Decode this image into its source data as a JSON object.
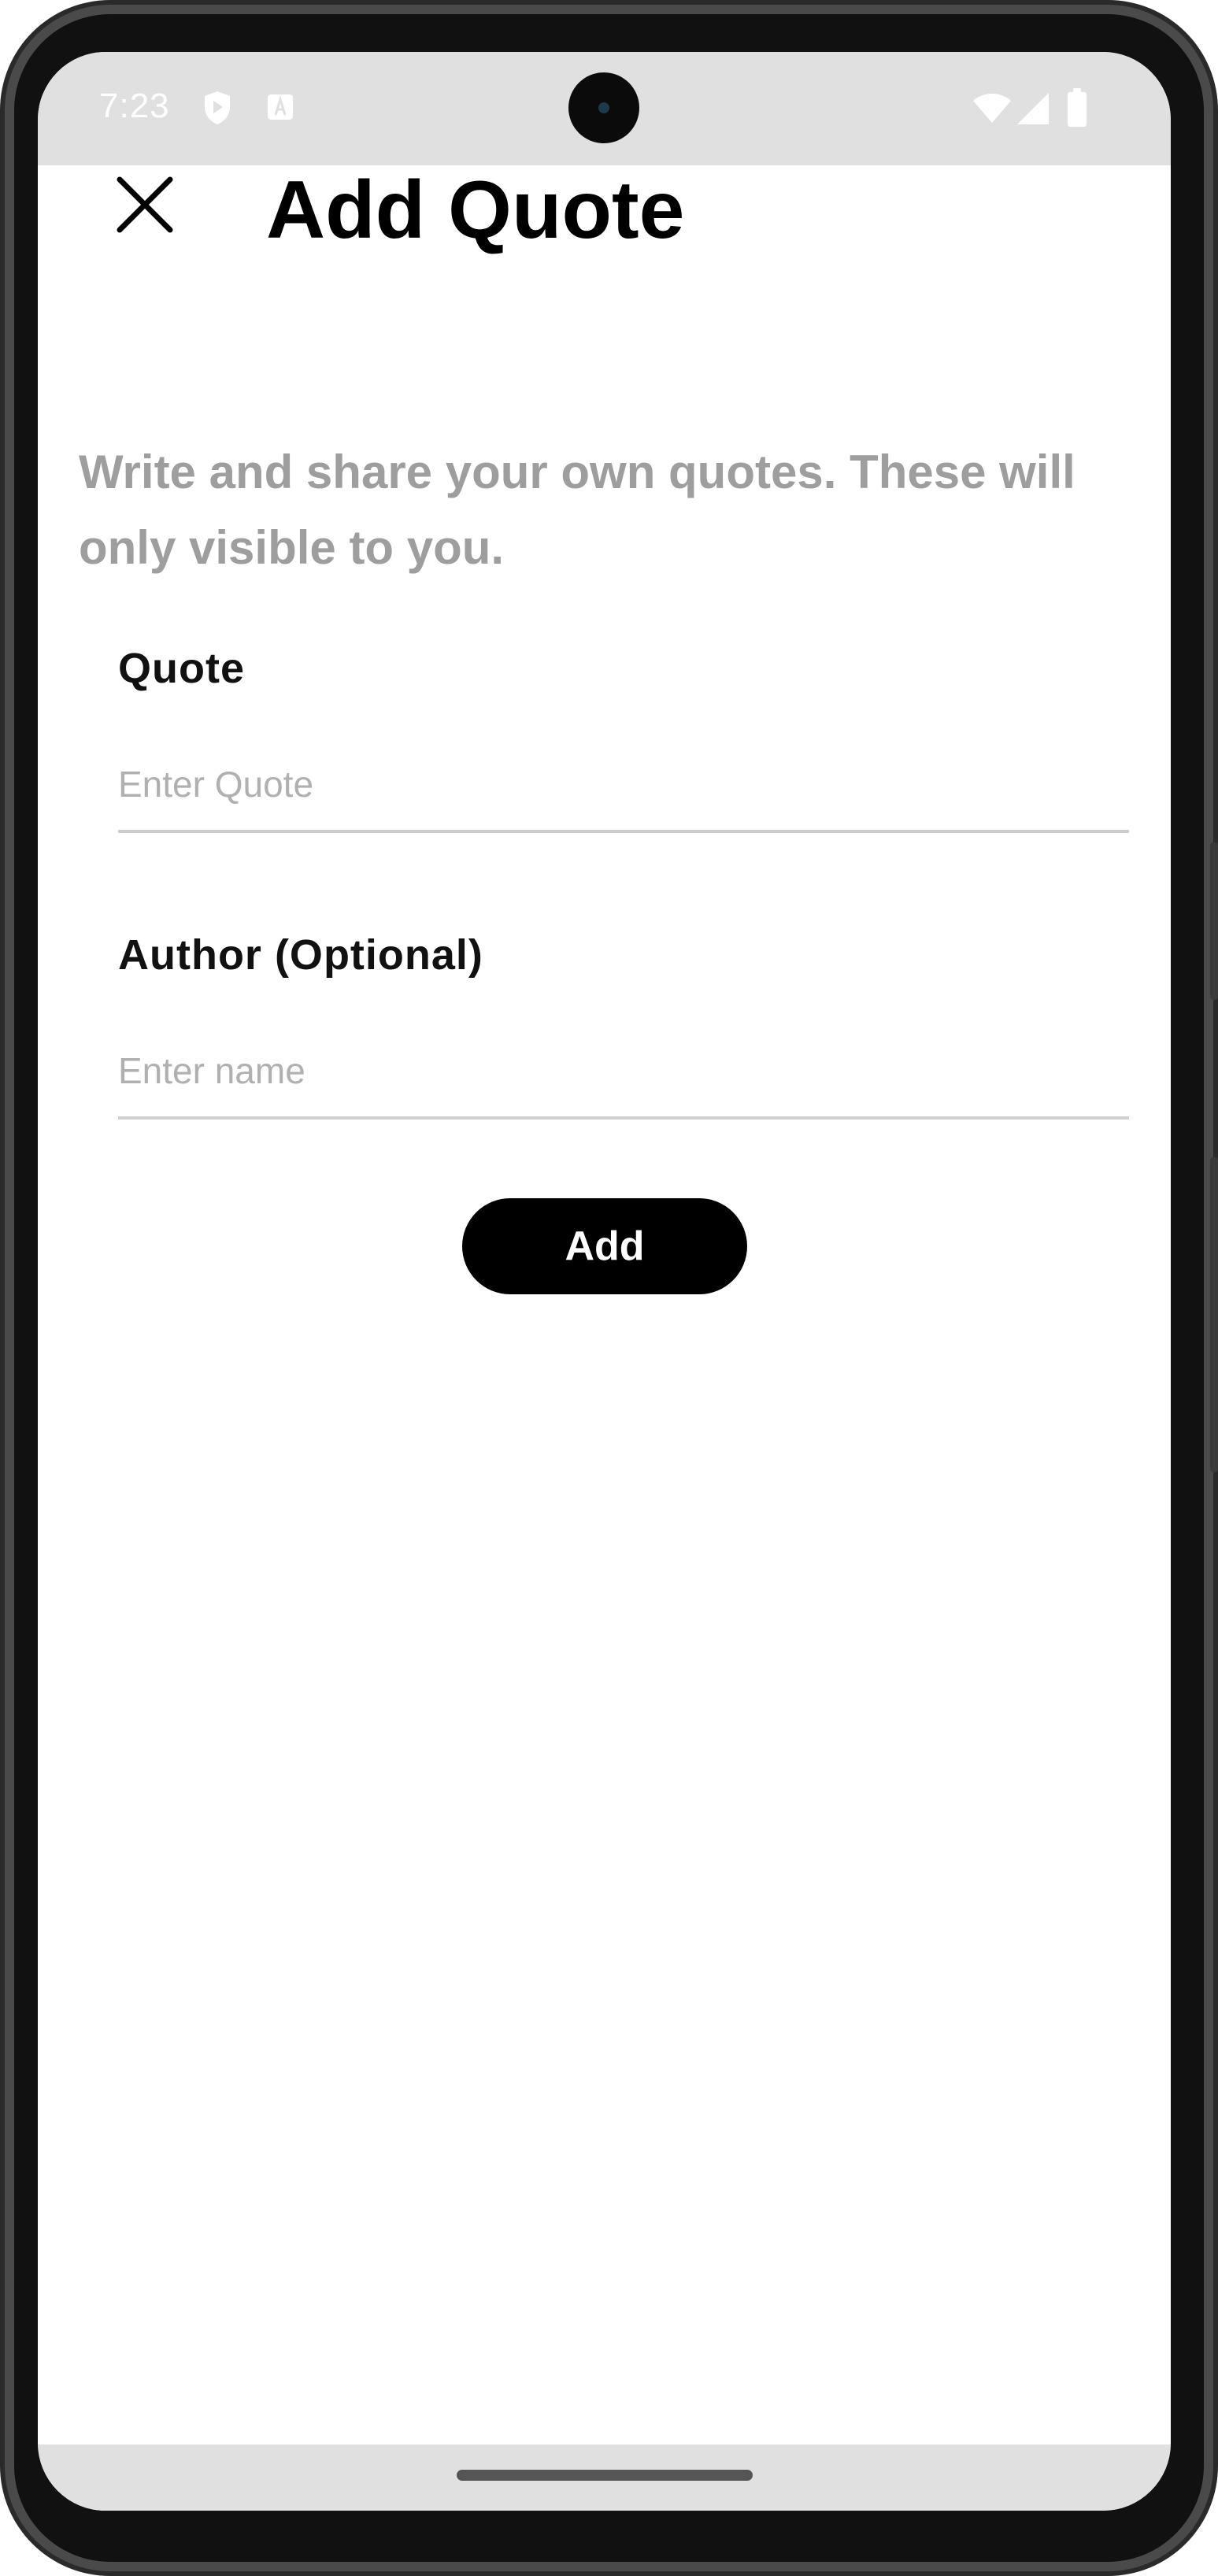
{
  "status_bar": {
    "time": "7:23",
    "icons": [
      "shield-icon",
      "a-icon",
      "wifi-icon",
      "signal-icon",
      "battery-icon"
    ]
  },
  "header": {
    "title": "Add Quote",
    "close_icon": "close-icon"
  },
  "description": "Write and share your own quotes. These will only visible to you.",
  "form": {
    "quote": {
      "label": "Quote",
      "placeholder": "Enter Quote",
      "value": ""
    },
    "author": {
      "label": "Author (Optional)",
      "placeholder": "Enter name",
      "value": ""
    },
    "submit_label": "Add"
  },
  "colors": {
    "status_bar_bg": "#e0e0e0",
    "description_text": "#9e9e9e",
    "button_bg": "#000000",
    "button_text": "#ffffff",
    "input_underline": "#cfcfcf"
  }
}
